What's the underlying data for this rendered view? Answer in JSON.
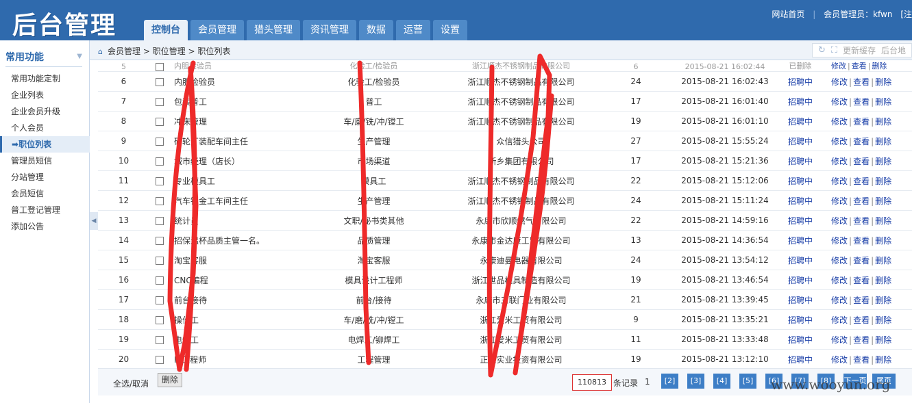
{
  "app": {
    "logo": "后台管理",
    "top_links": [
      "网站首页",
      "会员管理员：kfwn",
      "[注"
    ]
  },
  "nav": {
    "tabs": [
      {
        "label": "控制台",
        "active": true
      },
      {
        "label": "会员管理",
        "active": false
      },
      {
        "label": "猎头管理",
        "active": false
      },
      {
        "label": "资讯管理",
        "active": false
      },
      {
        "label": "数据",
        "active": false
      },
      {
        "label": "运营",
        "active": false
      },
      {
        "label": "设置",
        "active": false
      }
    ]
  },
  "breadcrumb": {
    "path": "会员管理 > 职位管理 > 职位列表"
  },
  "tools": {
    "refresh_cache": "更新缓存",
    "backend_addr": "后台地"
  },
  "sidebar": {
    "title": "常用功能",
    "items": [
      {
        "label": "常用功能定制",
        "active": false
      },
      {
        "label": "企业列表",
        "active": false
      },
      {
        "label": "企业会员升级",
        "active": false
      },
      {
        "label": "个人会员",
        "active": false
      },
      {
        "label": "职位列表",
        "active": true
      },
      {
        "label": "管理员短信",
        "active": false
      },
      {
        "label": "分站管理",
        "active": false
      },
      {
        "label": "会员短信",
        "active": false
      },
      {
        "label": "普工登记管理",
        "active": false
      },
      {
        "label": "添加公告",
        "active": false
      }
    ]
  },
  "table": {
    "partial_row": {
      "idx": "5",
      "title": "内胆检验员",
      "category": "化验工/检验员",
      "company": "浙江顺杰不锈钢制品有限公司",
      "num": "6",
      "time": "2015-08-21 16:02:44",
      "status": "已删除"
    },
    "rows": [
      {
        "idx": "6",
        "title": "内胆检验员",
        "category": "化验工/检验员",
        "company": "浙江顺杰不锈钢制品有限公司",
        "num": "24",
        "time": "2015-08-21 16:02:43",
        "status": "招聘中"
      },
      {
        "idx": "7",
        "title": "包装普工",
        "category": "普工",
        "company": "浙江顺杰不锈钢制品有限公司",
        "num": "17",
        "time": "2015-08-21 16:01:40",
        "status": "招聘中"
      },
      {
        "idx": "8",
        "title": "冲床管理",
        "category": "车/磨/铣/冲/镗工",
        "company": "浙江顺杰不锈钢制品有限公司",
        "num": "19",
        "time": "2015-08-21 16:01:10",
        "status": "招聘中"
      },
      {
        "idx": "9",
        "title": "砂轮厂装配车间主任",
        "category": "生产管理",
        "company": "众信猎头公司",
        "num": "27",
        "time": "2015-08-21 15:55:24",
        "status": "招聘中"
      },
      {
        "idx": "10",
        "title": "城市经理（店长）",
        "category": "市场渠道",
        "company": "新乡集团有限公司",
        "num": "17",
        "time": "2015-08-21 15:21:36",
        "status": "招聘中"
      },
      {
        "idx": "11",
        "title": "专业模具工",
        "category": "模具工",
        "company": "浙江顺杰不锈钢制品有限公司",
        "num": "22",
        "time": "2015-08-21 15:12:06",
        "status": "招聘中"
      },
      {
        "idx": "12",
        "title": "汽车钣金工车间主任",
        "category": "生产管理",
        "company": "浙江顺杰不锈钢制品有限公司",
        "num": "24",
        "time": "2015-08-21 15:11:24",
        "status": "招聘中"
      },
      {
        "idx": "13",
        "title": "统计员",
        "category": "文职/秘书类其他",
        "company": "永康市欣顺燃气有限公司",
        "num": "22",
        "time": "2015-08-21 14:59:16",
        "status": "招聘中"
      },
      {
        "idx": "14",
        "title": "招保温杯品质主管一名。",
        "category": "品质管理",
        "company": "永康市金达康工贸有限公司",
        "num": "13",
        "time": "2015-08-21 14:36:54",
        "status": "招聘中"
      },
      {
        "idx": "15",
        "title": "淘宝客服",
        "category": "淘宝客服",
        "company": "永康迪曼电器有限公司",
        "num": "24",
        "time": "2015-08-21 13:54:12",
        "status": "招聘中"
      },
      {
        "idx": "16",
        "title": "CNC编程",
        "category": "模具设计工程师",
        "company": "浙江世品模具制造有限公司",
        "num": "19",
        "time": "2015-08-21 13:46:54",
        "status": "招聘中"
      },
      {
        "idx": "17",
        "title": "前台接待",
        "category": "前台/接待",
        "company": "永康市三联门业有限公司",
        "num": "21",
        "time": "2015-08-21 13:39:45",
        "status": "招聘中"
      },
      {
        "idx": "18",
        "title": "操作工",
        "category": "车/磨/铣/冲/镗工",
        "company": "浙江爱米工贸有限公司",
        "num": "9",
        "time": "2015-08-21 13:35:21",
        "status": "招聘中"
      },
      {
        "idx": "19",
        "title": "电焊工",
        "category": "电焊工/铆焊工",
        "company": "浙江爱米工贸有限公司",
        "num": "11",
        "time": "2015-08-21 13:33:48",
        "status": "招聘中"
      },
      {
        "idx": "20",
        "title": "IE工程师",
        "category": "工程管理",
        "company": "正阳实业投资有限公司",
        "num": "19",
        "time": "2015-08-21 13:12:10",
        "status": "招聘中"
      }
    ],
    "ops": {
      "edit": "修改",
      "view": "查看",
      "delete": "删除",
      "sep": "|"
    }
  },
  "footer": {
    "select_all": "全选/取消",
    "delete_button": "删除",
    "total": "110813",
    "total_label": "条记录",
    "current_page": "1",
    "pages": [
      "[2]",
      "[3]",
      "[4]",
      "[5]",
      "[6]",
      "[7]",
      "[8]",
      "下一页",
      "尾页"
    ]
  },
  "watermark": "www.wooyun.org"
}
